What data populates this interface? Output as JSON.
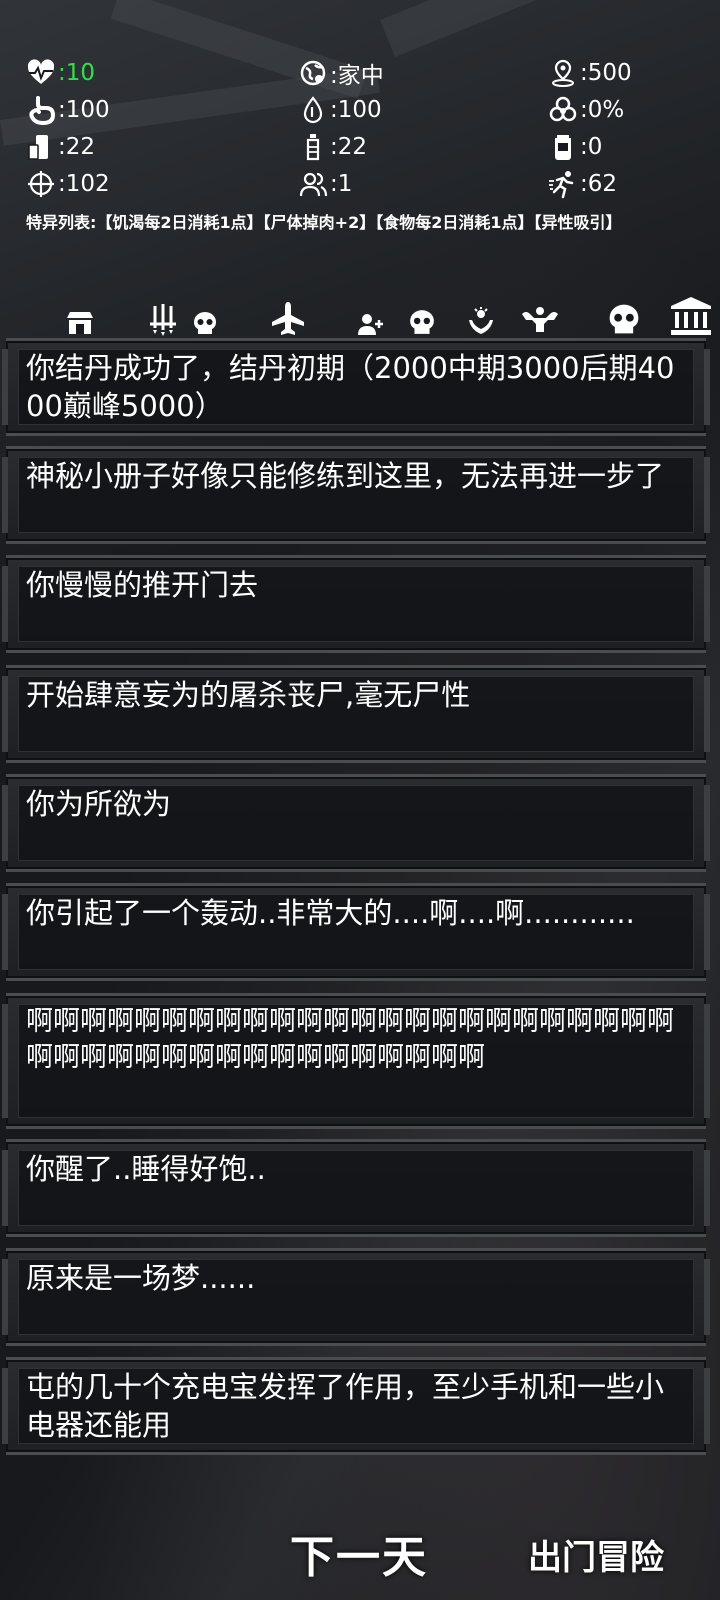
{
  "stats": [
    {
      "icon": "heartbeat-icon",
      "value": ":10",
      "color": "#33e04a"
    },
    {
      "icon": "globe-location-icon",
      "value": ":家中"
    },
    {
      "icon": "map-pin-icon",
      "value": ":500"
    },
    {
      "icon": "stomach-icon",
      "value": ":100"
    },
    {
      "icon": "water-drop-icon",
      "value": ":100"
    },
    {
      "icon": "biohazard-icon",
      "value": ":0%"
    },
    {
      "icon": "food-can-icon",
      "value": ":22"
    },
    {
      "icon": "bottle-icon",
      "value": ":22"
    },
    {
      "icon": "jar-icon",
      "value": ":0"
    },
    {
      "icon": "crosshair-icon",
      "value": ":102"
    },
    {
      "icon": "people-icon",
      "value": ":1"
    },
    {
      "icon": "running-icon",
      "value": ":62"
    }
  ],
  "traits": "特异列表:【饥渴每2日消耗1点】【尸体掉肉+2】【食物每2日消耗1点】【异性吸引】",
  "iconbar": [
    "shop-icon",
    "weapons-icon",
    "skull-icon",
    "airplane-icon",
    "add-user-icon",
    "skull-icon",
    "magic-hands-icon",
    "muscle-icon",
    "skull-large-icon",
    "bank-icon"
  ],
  "messages": [
    "你结丹成功了，结丹初期（2000中期3000后期4000巅峰5000）",
    "神秘小册子好像只能修练到这里，无法再进一步了",
    "你慢慢的推开门去",
    "开始肆意妄为的屠杀丧尸,毫无尸性",
    "你为所欲为",
    "你引起了一个轰动..非常大的....啊....啊............",
    "啊啊啊啊啊啊啊啊啊啊啊啊啊啊啊啊啊啊啊啊啊啊啊啊啊啊啊啊啊啊啊啊啊啊啊啊啊啊啊啊啊",
    "你醒了..睡得好饱..",
    "原来是一场梦......",
    "屯的几十个充电宝发挥了作用，至少手机和一些小电器还能用"
  ],
  "buttons": {
    "next_day": "下一天",
    "go_out": "出门冒险"
  }
}
